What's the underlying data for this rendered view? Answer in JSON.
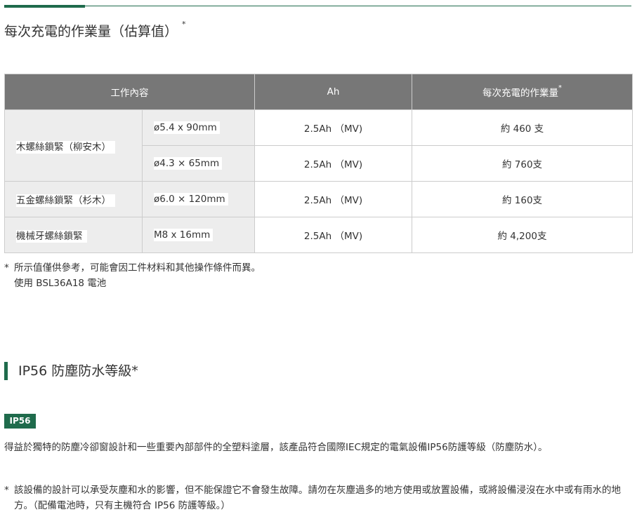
{
  "runtime_section": {
    "title": "每次充電的作業量（估算值）",
    "title_mark": "*",
    "table": {
      "headers": {
        "task": "工作內容",
        "ah": "Ah",
        "runtime": "每次充電的作業量",
        "runtime_mark": "*"
      },
      "rows": [
        {
          "task": "木螺絲鎖緊（柳安木）",
          "size": "ø5.4 x 90mm",
          "ah": "2.5Ah （MV)",
          "runtime": "約 460 支"
        },
        {
          "size": "ø4.3 × 65mm",
          "ah": "2.5Ah （MV)",
          "runtime": "約 760支"
        },
        {
          "task": "五金螺絲鎖緊（杉木）",
          "size": "ø6.0 × 120mm",
          "ah": "2.5Ah （MV)",
          "runtime": "約 160支"
        },
        {
          "task": "機械牙螺絲鎖緊",
          "size": "M8 x 16mm",
          "ah": "2.5Ah （MV)",
          "runtime": "約 4,200支"
        }
      ]
    },
    "notes": {
      "mark": "*",
      "line1": "所示值僅供參考，可能會因工件材料和其他操作條件而異。",
      "line2": "使用 BSL36A18 電池"
    }
  },
  "ip_section": {
    "heading": "IP56 防塵防水等級*",
    "badge": "IP56",
    "description": "得益於獨特的防塵冷卻窗設計和一些重要內部部件的全塑料塗層，該產品符合國際IEC規定的電氣設備IP56防護等級（防塵防水）。",
    "caution_mark": "*",
    "caution": "該設備的設計可以承受灰塵和水的影響，但不能保證它不會發生故障。請勿在灰塵過多的地方使用或放置設備，或將設備浸沒在水中或有雨水的地方。（配備電池時，只有主機符合 IP56 防護等級。）"
  },
  "colors": {
    "accent": "#1f6b4c",
    "table_header": "#777777",
    "cell_shade": "#ededed",
    "border": "#cccccc"
  }
}
